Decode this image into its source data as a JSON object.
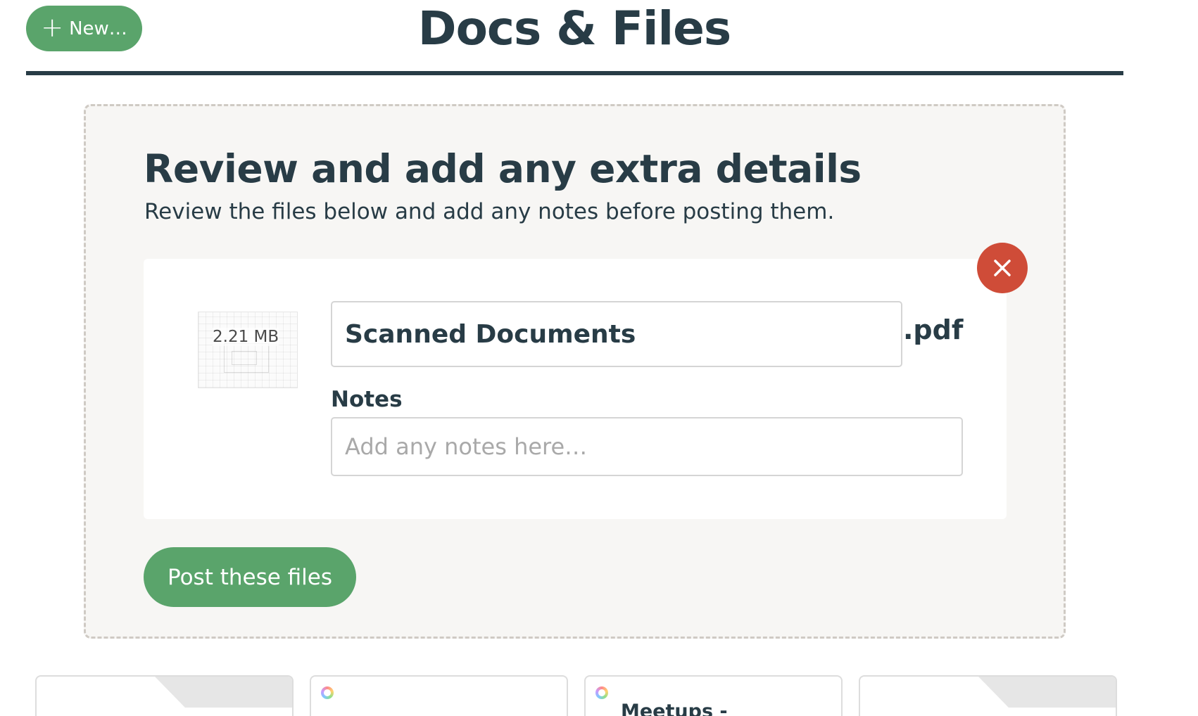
{
  "header": {
    "new_label": "New…",
    "title": "Docs & Files"
  },
  "review": {
    "heading": "Review and add any extra details",
    "subheading": "Review the files below and add any notes before posting them.",
    "file": {
      "size": "2.21 MB",
      "name": "Scanned Documents",
      "extension": ".pdf",
      "notes_label": "Notes",
      "notes_placeholder": "Add any notes here…",
      "notes_value": ""
    },
    "post_label": "Post these files"
  },
  "cards": [
    {
      "kind": "folder",
      "title": ""
    },
    {
      "kind": "doc",
      "title": ""
    },
    {
      "kind": "doc",
      "title": "Meetups -"
    },
    {
      "kind": "folder",
      "title": ""
    }
  ],
  "colors": {
    "accent_green": "#5aa46b",
    "danger_red": "#cf4c38",
    "text_dark": "#283c46"
  }
}
